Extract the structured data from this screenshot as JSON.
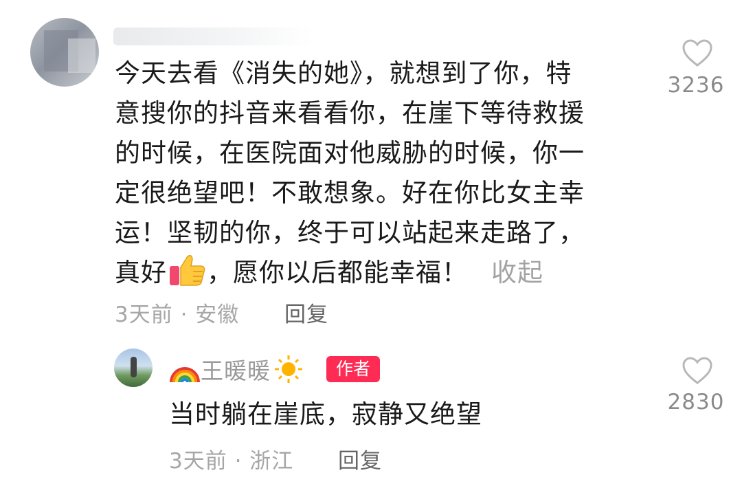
{
  "comment": {
    "text_lines": [
      "今天去看《消失的她》，就想到了你，特",
      "意搜你的抖音来看看你，在崖下等待救援",
      "的时候，在医院面对他威胁的时候，你一",
      "定很绝望吧！不敢想象。好在你比女主幸",
      "运！坚韧的你，终于可以站起来走路了，"
    ],
    "last_line_before": "真好",
    "last_line_after": "，愿你以后都能幸福！",
    "collapse_label": "收起",
    "meta": "3天前 · 安徽",
    "reply_label": "回复",
    "likes": "3236",
    "inline_icon": "thumbs-up-emoji"
  },
  "reply": {
    "author_prefix_icon": "rainbow-emoji",
    "author": "王暖暖",
    "author_suffix_icon": "sun-emoji",
    "badge": "作者",
    "text": "当时躺在崖底，寂静又绝望",
    "meta": "3天前 · 浙江",
    "reply_label": "回复",
    "likes": "2830"
  },
  "colors": {
    "badge_bg": "#fe2c55",
    "text": "#1a1a1a",
    "muted": "#a6a6a6"
  }
}
